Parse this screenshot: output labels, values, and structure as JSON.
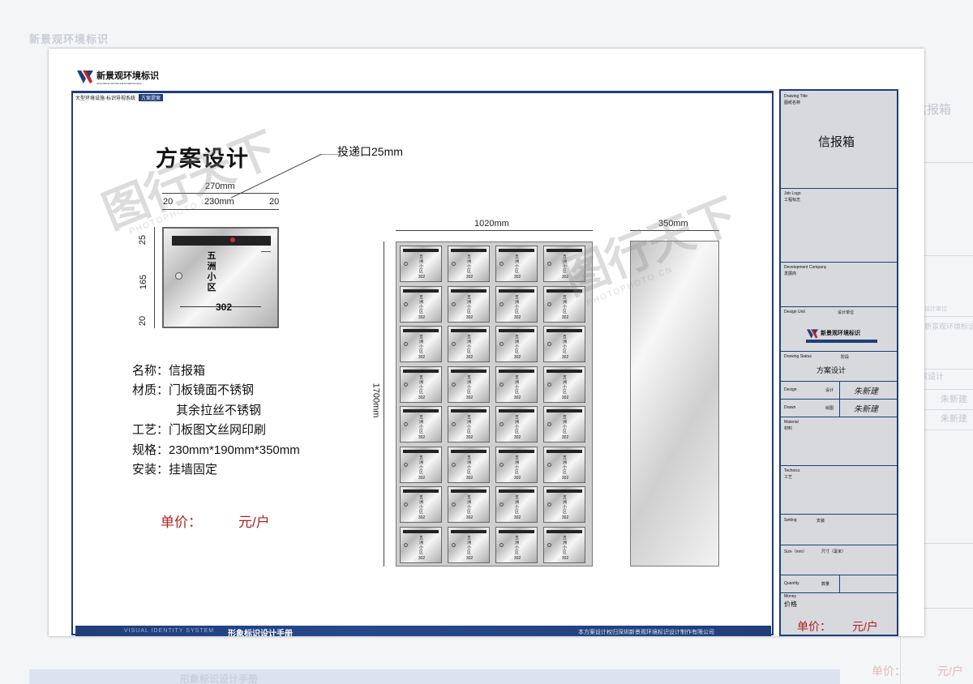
{
  "background": {
    "logo_text": "新景观环境标识",
    "footer_title": "形象标识设计手册",
    "price_label": "单价：",
    "price_unit": "元/户",
    "side_texts": [
      "信报箱",
      "设计单位",
      "新景观环境标识",
      "方案设计",
      "朱新建",
      "朱新建"
    ]
  },
  "header": {
    "company_name": "新景观环境标识",
    "company_pinyin": "XINJINGGUANHUANJINGBIAOSHI",
    "tagline": "大型环境设施·标识导视系统",
    "tagline_tag": "方案提案"
  },
  "title": "方案设计",
  "callout": {
    "slot_label": "投递口25mm"
  },
  "dimensions": {
    "box_width_total": "270mm",
    "box_margin_left": "20",
    "box_inner_width": "230mm",
    "box_margin_right": "20",
    "box_top_margin": "25",
    "box_height": "165",
    "box_bottom_margin": "20",
    "cabinet_width": "1020mm",
    "cabinet_height": "1700mm",
    "cabinet_depth": "350mm"
  },
  "single_box": {
    "vertical_label": "五洲小区",
    "number": "302"
  },
  "specs": [
    {
      "label": "名称：",
      "value": "信报箱"
    },
    {
      "label": "材质：",
      "value": "门板镜面不锈钢"
    },
    {
      "label": "",
      "value": "其余拉丝不锈钢"
    },
    {
      "label": "工艺：",
      "value": "门板图文丝网印刷"
    },
    {
      "label": "规格：",
      "value": "230mm*190mm*350mm"
    },
    {
      "label": "安装：",
      "value": "挂墙固定"
    }
  ],
  "price": {
    "label": "单价：",
    "unit": "元/户"
  },
  "cabinet": {
    "rows": 8,
    "cols": 4,
    "cell_label": "五洲小区",
    "cell_number": "302"
  },
  "footer": {
    "left_en": "VISUAL IDENTITY SYSTEM",
    "left_cn": "形象标识设计手册",
    "right_text": "本方案设计权归深圳新景观环境标识设计制作有限公司"
  },
  "title_block": {
    "drawing_title_label": "Drawing Title",
    "drawing_title_label_cn": "图纸名称",
    "drawing_title": "信报箱",
    "job_logo_label": "Job Logo",
    "job_logo_label_cn": "工程标志",
    "dev_company_label": "Development Company",
    "dev_company_label_cn": "发展商",
    "design_unit_label": "Design Unit",
    "design_unit_label_cn": "设计单位",
    "design_unit_logo_text": "新景观环境标识",
    "drawing_status_label": "Drawing Status",
    "drawing_status_label_cn": "阶段",
    "drawing_status": "方案设计",
    "design_label": "Design",
    "design_label_cn": "设计",
    "design_name": "朱新建",
    "drawn_label": "Drawn",
    "drawn_label_cn": "绘图",
    "drawn_name": "朱新建",
    "material_label": "Material",
    "material_label_cn": "材料",
    "technics_label": "Technics",
    "technics_label_cn": "工艺",
    "setting_label": "Setting",
    "setting_label_cn": "安装",
    "size_label": "Size（mm）",
    "size_label_cn": "尺寸（毫米）",
    "quantity_label": "Quantity",
    "quantity_label_cn": "数量",
    "money_label": "Money",
    "money_label_cn": "价格",
    "price_label": "单价：",
    "price_unit": "元/户"
  },
  "watermark": {
    "text": "图行天下",
    "url": "PHOTOPHOTO.CN"
  },
  "colors": {
    "brand_blue": "#1f3e7a",
    "price_red": "#b02020",
    "title_block_bg": "#d7d9dd"
  }
}
